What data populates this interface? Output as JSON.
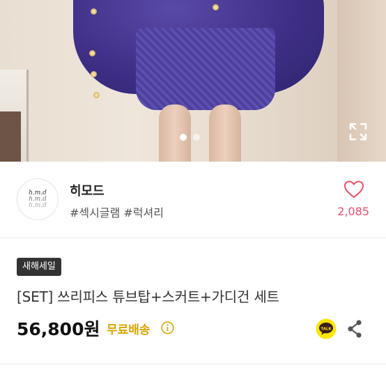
{
  "gallery": {
    "total_images": 2,
    "active_index": 0
  },
  "shop": {
    "logo_lines": [
      "h.m.d",
      "h.m.d",
      "h.m.d"
    ],
    "name": "히모드",
    "tags": "#섹시글램 #럭셔리",
    "likes": "2,085"
  },
  "product": {
    "badge": "새해세일",
    "title": "[SET] 쓰리피스 튜브탑+스커트+가디건 세트",
    "price": "56,800원",
    "shipping": "무료배송"
  },
  "colors": {
    "accent_like": "#ef4d6a",
    "shipping": "#d9a400",
    "talk_bg": "#fee500"
  },
  "icons": {
    "expand": "expand-icon",
    "like": "heart-outline-icon",
    "info": "info-icon",
    "talk": "kakao-talk-icon",
    "share": "share-icon"
  }
}
